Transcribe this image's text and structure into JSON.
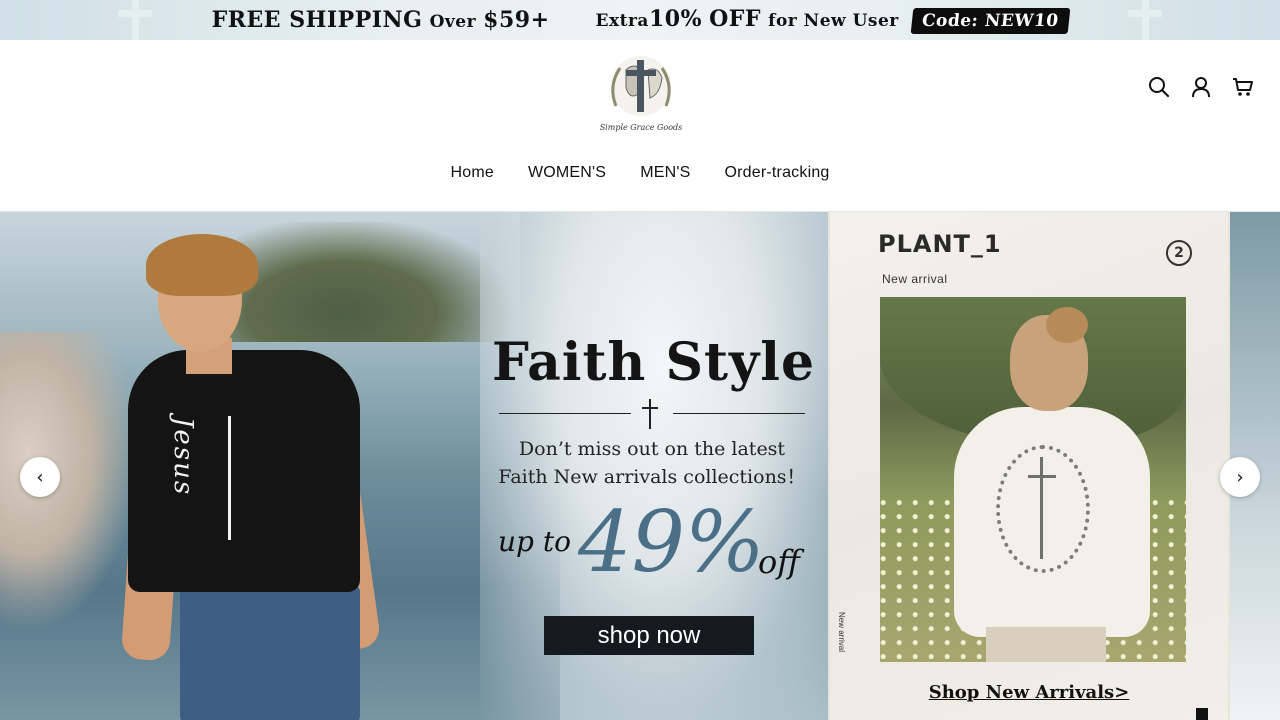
{
  "announcement": {
    "left_text_a": "FREE SHIPPING",
    "left_text_b": "Over",
    "left_text_c": "$59+",
    "right_text_a": "Extra",
    "right_text_b": "10%",
    "right_text_c": "OFF",
    "right_text_d": "for New User",
    "code": "Code: NEW10"
  },
  "header": {
    "logo_text": "Simple Grace Goods",
    "icons": [
      "search-icon",
      "account-icon",
      "cart-icon"
    ]
  },
  "nav": {
    "items": [
      {
        "label": "Home"
      },
      {
        "label": "WOMEN'S"
      },
      {
        "label": "MEN'S"
      },
      {
        "label": "Order-tracking"
      }
    ]
  },
  "hero": {
    "title": "Faith Style",
    "subtitle_line1": "Don’t miss out on the latest",
    "subtitle_line2": "Faith New arrivals collections！",
    "up_to": "up to",
    "percent": "49%",
    "off": "off",
    "cta": "shop now",
    "man_shirt_text": "Jesus",
    "card": {
      "title": "PLANT_1",
      "number": "2",
      "subtitle": "New arrival",
      "side_text": "New arrival",
      "link": "Shop New Arrivals>"
    },
    "prev_arrow": "‹",
    "next_arrow": "›"
  },
  "colors": {
    "accent_blue": "#4a6f87",
    "button_dark": "#141a1f"
  }
}
